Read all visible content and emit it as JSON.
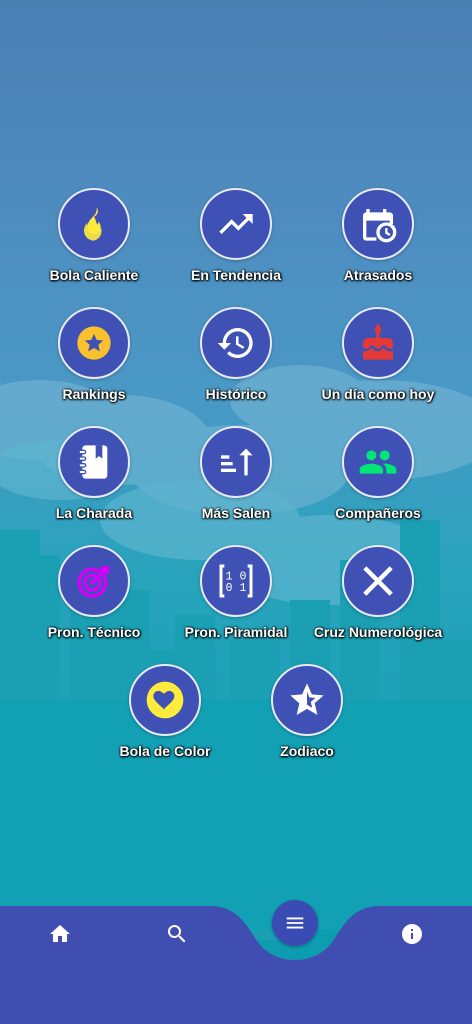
{
  "menu": {
    "items": [
      {
        "label": "Bola Caliente",
        "icon": "flame-icon"
      },
      {
        "label": "En Tendencia",
        "icon": "trending-up-icon"
      },
      {
        "label": "Atrasados",
        "icon": "calendar-clock-icon"
      },
      {
        "label": "Rankings",
        "icon": "star-badge-icon"
      },
      {
        "label": "Histórico",
        "icon": "history-icon"
      },
      {
        "label": "Un día como hoy",
        "icon": "birthday-cake-icon"
      },
      {
        "label": "La Charada",
        "icon": "notebook-icon"
      },
      {
        "label": "Más Salen",
        "icon": "sort-ascending-icon"
      },
      {
        "label": "Compañeros",
        "icon": "group-icon"
      },
      {
        "label": "Pron. Técnico",
        "icon": "target-arrow-icon"
      },
      {
        "label": "Pron. Piramidal",
        "icon": "binary-matrix-icon"
      },
      {
        "label": "Cruz Numerológica",
        "icon": "cross-x-icon"
      },
      {
        "label": "Bola de Color",
        "icon": "heart-ball-icon"
      },
      {
        "label": "Zodiaco",
        "icon": "star-outline-icon"
      }
    ]
  },
  "bottom_nav": {
    "items": [
      {
        "name": "home",
        "icon": "home-icon"
      },
      {
        "name": "search",
        "icon": "search-icon"
      },
      {
        "name": "menu",
        "icon": "menu-icon"
      },
      {
        "name": "info",
        "icon": "info-icon"
      }
    ]
  },
  "colors": {
    "circle_bg": "#3f51b5",
    "nav_bg": "#3f4eb0",
    "flame": "#ffeb3b",
    "star_badge": "#fbc02d",
    "cake": "#e53935",
    "group": "#00e676",
    "target": "#d500f9",
    "heart_ball": "#ffeb3b"
  }
}
